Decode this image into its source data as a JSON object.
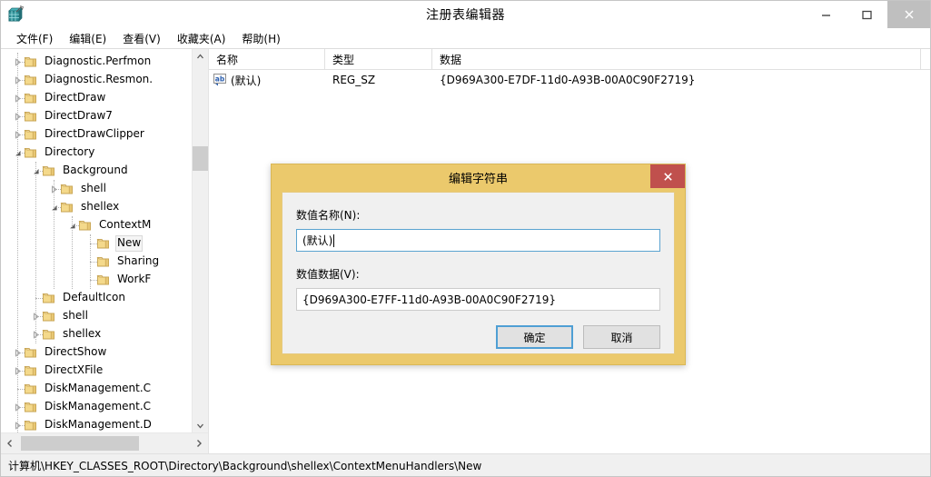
{
  "window": {
    "title": "注册表编辑器",
    "app_icon": "registry-editor-icon",
    "minimize_label": "最小化",
    "maximize_label": "最大化",
    "close_label": "关闭"
  },
  "menubar": {
    "items": [
      {
        "label": "文件(F)"
      },
      {
        "label": "编辑(E)"
      },
      {
        "label": "查看(V)"
      },
      {
        "label": "收藏夹(A)"
      },
      {
        "label": "帮助(H)"
      }
    ]
  },
  "tree": {
    "items": [
      {
        "label": "Diagnostic.Perfmon",
        "depth": 1,
        "twisty": "collapsed",
        "selected": false,
        "truncated": true
      },
      {
        "label": "Diagnostic.Resmon.",
        "depth": 1,
        "twisty": "collapsed",
        "selected": false,
        "truncated": true
      },
      {
        "label": "DirectDraw",
        "depth": 1,
        "twisty": "collapsed",
        "selected": false,
        "truncated": false
      },
      {
        "label": "DirectDraw7",
        "depth": 1,
        "twisty": "collapsed",
        "selected": false,
        "truncated": false
      },
      {
        "label": "DirectDrawClipper",
        "depth": 1,
        "twisty": "collapsed",
        "selected": false,
        "truncated": false
      },
      {
        "label": "Directory",
        "depth": 1,
        "twisty": "expanded",
        "selected": false,
        "truncated": false
      },
      {
        "label": "Background",
        "depth": 2,
        "twisty": "expanded",
        "selected": false,
        "truncated": false
      },
      {
        "label": "shell",
        "depth": 3,
        "twisty": "collapsed",
        "selected": false,
        "truncated": false
      },
      {
        "label": "shellex",
        "depth": 3,
        "twisty": "expanded",
        "selected": false,
        "truncated": false
      },
      {
        "label": "ContextM",
        "depth": 4,
        "twisty": "expanded",
        "selected": false,
        "truncated": true
      },
      {
        "label": "New",
        "depth": 5,
        "twisty": "none",
        "selected": true,
        "truncated": false
      },
      {
        "label": "Sharing",
        "depth": 5,
        "twisty": "none",
        "selected": false,
        "truncated": true
      },
      {
        "label": "WorkF",
        "depth": 5,
        "twisty": "none",
        "selected": false,
        "truncated": true
      },
      {
        "label": "DefaultIcon",
        "depth": 2,
        "twisty": "none",
        "selected": false,
        "truncated": false
      },
      {
        "label": "shell",
        "depth": 2,
        "twisty": "collapsed",
        "selected": false,
        "truncated": false
      },
      {
        "label": "shellex",
        "depth": 2,
        "twisty": "collapsed",
        "selected": false,
        "truncated": false
      },
      {
        "label": "DirectShow",
        "depth": 1,
        "twisty": "collapsed",
        "selected": false,
        "truncated": false
      },
      {
        "label": "DirectXFile",
        "depth": 1,
        "twisty": "collapsed",
        "selected": false,
        "truncated": false
      },
      {
        "label": "DiskManagement.C",
        "depth": 1,
        "twisty": "none",
        "selected": false,
        "truncated": true
      },
      {
        "label": "DiskManagement.C",
        "depth": 1,
        "twisty": "collapsed",
        "selected": false,
        "truncated": true
      },
      {
        "label": "DiskManagement.D",
        "depth": 1,
        "twisty": "collapsed",
        "selected": false,
        "truncated": true
      }
    ]
  },
  "list": {
    "columns": [
      "名称",
      "类型",
      "数据"
    ],
    "rows": [
      {
        "icon": "string-value-icon",
        "name": "(默认)",
        "type": "REG_SZ",
        "data": "{D969A300-E7DF-11d0-A93B-00A0C90F2719}"
      }
    ]
  },
  "statusbar": {
    "path": "计算机\\HKEY_CLASSES_ROOT\\Directory\\Background\\shellex\\ContextMenuHandlers\\New"
  },
  "dialog": {
    "title": "编辑字符串",
    "close_label": "关闭",
    "name_label": "数值名称(N):",
    "name_value": "(默认)",
    "data_label": "数值数据(V):",
    "data_value": "{D969A300-E7FF-11d0-A93B-00A0C90F2719}",
    "ok_label": "确定",
    "cancel_label": "取消"
  },
  "colors": {
    "dialog_border": "#ebc96c",
    "dialog_close": "#c0504d",
    "focus_blue": "#4f9fd4",
    "scrollbar_thumb": "#cdcdcd",
    "titlebar_close_hover": "#bfbfbf"
  }
}
